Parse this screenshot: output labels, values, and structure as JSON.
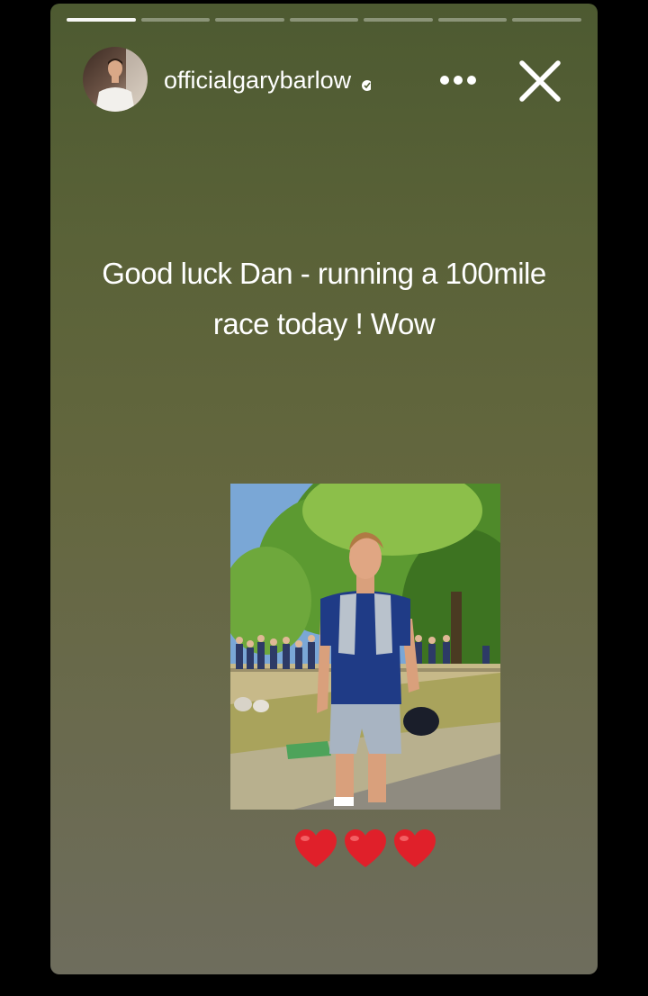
{
  "story": {
    "segments": [
      {
        "state": "active"
      },
      {
        "state": "pending"
      },
      {
        "state": "pending"
      },
      {
        "state": "pending"
      },
      {
        "state": "pending"
      },
      {
        "state": "pending"
      },
      {
        "state": "pending"
      }
    ],
    "username": "officialgarybarlow",
    "verified_icon": "verified-badge-icon",
    "more_icon": "more-options-icon",
    "close_icon": "close-icon",
    "caption": {
      "line1": "Good luck Dan - running a 100mile",
      "line2": "race today ! Wow"
    },
    "photo": "runner-photo",
    "hearts": [
      "heart-emoji",
      "heart-emoji",
      "heart-emoji"
    ],
    "colors": {
      "background_top": "#4d5a31",
      "background_bottom": "#6e6d5d",
      "heart": "#e0202a"
    }
  }
}
